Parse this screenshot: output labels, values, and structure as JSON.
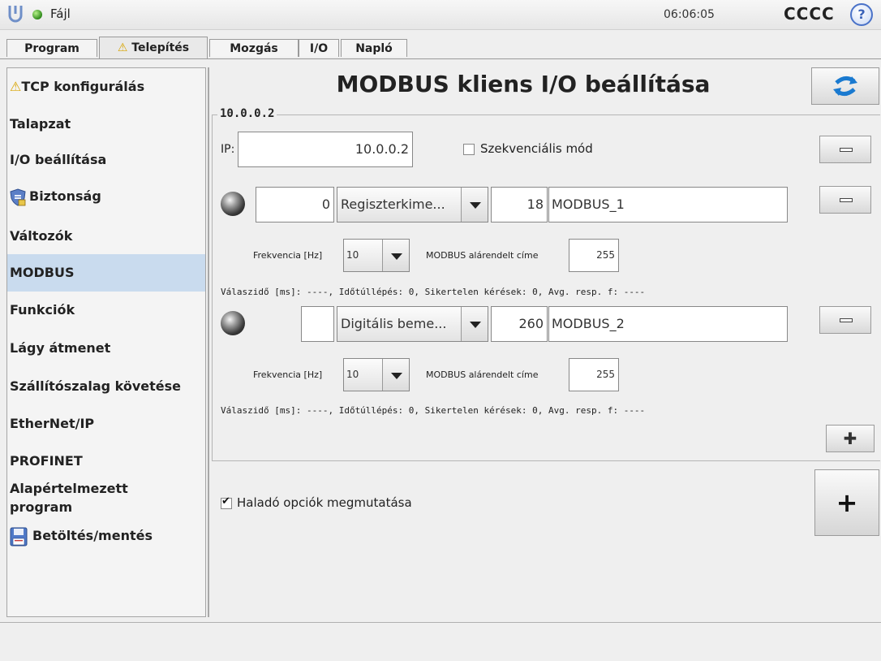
{
  "app": {
    "menu_file": "Fájl",
    "clock": "06:06:05",
    "robot_name": "CCCC",
    "help_glyph": "?"
  },
  "tabs": [
    {
      "label": "Program"
    },
    {
      "label": "Telepítés",
      "icon": "warning-icon",
      "active": true
    },
    {
      "label": "Mozgás"
    },
    {
      "label": "I/O"
    },
    {
      "label": "Napló"
    }
  ],
  "sidebar": {
    "items": [
      {
        "label": "TCP konfigurálás",
        "icon": "warning-icon"
      },
      {
        "label": "Talapzat"
      },
      {
        "label": "I/O beállítása"
      },
      {
        "label": "Biztonság",
        "icon": "shield-icon"
      },
      {
        "label": "Változók"
      },
      {
        "label": "MODBUS",
        "selected": true
      },
      {
        "label": "Funkciók"
      },
      {
        "label": "Lágy átmenet"
      },
      {
        "label": "Szállítószalag követése"
      },
      {
        "label": "EtherNet/IP"
      },
      {
        "label": "PROFINET"
      },
      {
        "label": "Alapértelmezett program"
      },
      {
        "label": "Betöltés/mentés",
        "icon": "floppy-icon"
      }
    ]
  },
  "main": {
    "title": "MODBUS kliens I/O beállítása",
    "client": {
      "legend": "10.0.0.2",
      "ip_label": "IP:",
      "ip_value": "10.0.0.2",
      "sequential_label": "Szekvenciális mód",
      "sequential_checked": false
    },
    "signals": [
      {
        "address": "0",
        "type": "Regiszterkime...",
        "value": "18",
        "name": "MODBUS_1",
        "freq_label": "Frekvencia [Hz]",
        "freq_value": "10",
        "slave_label": "MODBUS alárendelt címe",
        "slave_value": "255",
        "status": "Válaszidő [ms]: ----, Időtúllépés: 0, Sikertelen kérések: 0, Avg. resp. f: ----"
      },
      {
        "address": "",
        "type": "Digitális beme...",
        "value": "260",
        "name": "MODBUS_2",
        "freq_label": "Frekvencia [Hz]",
        "freq_value": "10",
        "slave_label": "MODBUS alárendelt címe",
        "slave_value": "255",
        "status": "Válaszidő [ms]: ----, Időtúllépés: 0, Sikertelen kérések: 0, Avg. resp. f: ----"
      }
    ],
    "advanced_label": "Haladó opciók megmutatása",
    "advanced_checked": true,
    "add_small_glyph": "✚",
    "add_big_glyph": "+"
  },
  "colors": {
    "selected_bg": "#c9dbee",
    "warning": "#d8a400",
    "status_dot": "#2e8a1a",
    "accent_blue": "#1a7ad0"
  }
}
